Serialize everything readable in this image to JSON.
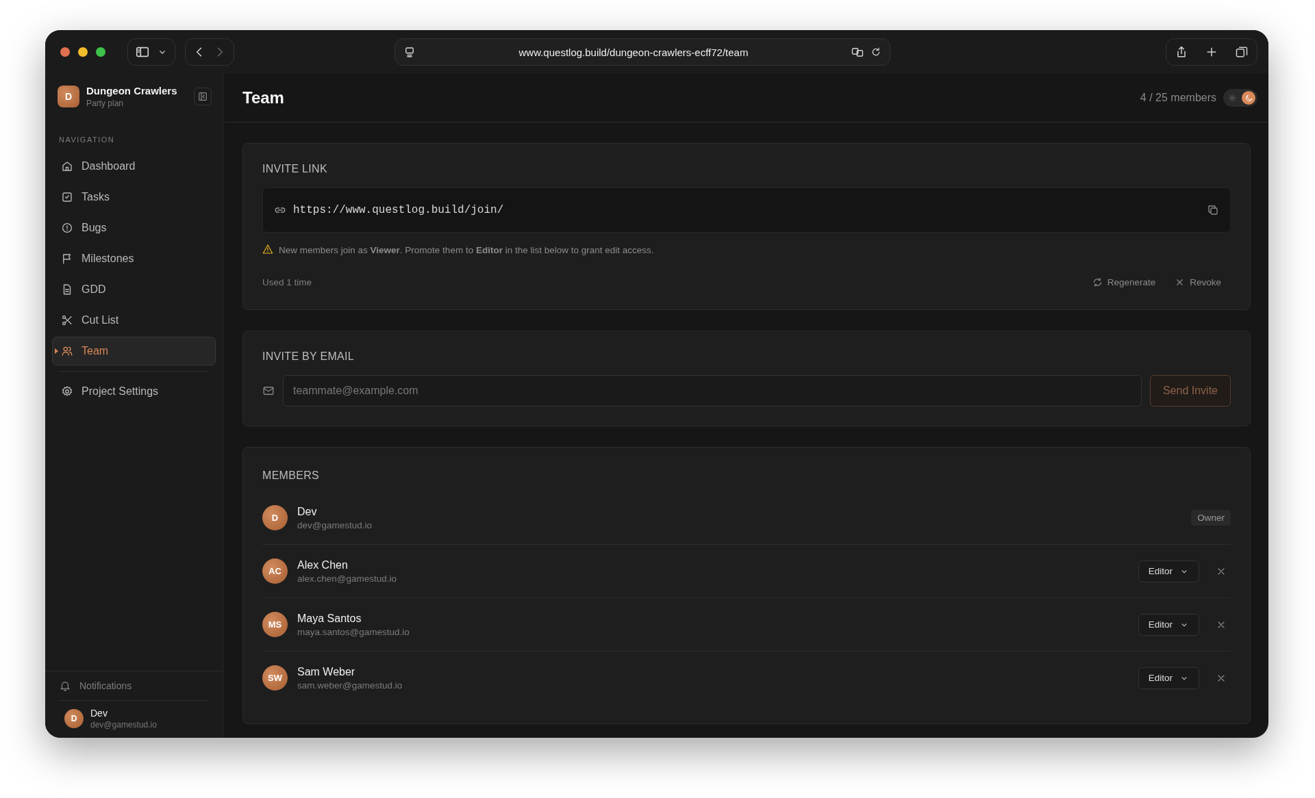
{
  "browser": {
    "url": "www.questlog.build/dungeon-crawlers-ecff72/team"
  },
  "sidebar": {
    "project": {
      "avatar": "D",
      "name": "Dungeon Crawlers",
      "plan": "Party plan"
    },
    "section_label": "NAVIGATION",
    "items": [
      {
        "label": "Dashboard",
        "selected": false
      },
      {
        "label": "Tasks",
        "selected": false
      },
      {
        "label": "Bugs",
        "selected": false
      },
      {
        "label": "Milestones",
        "selected": false
      },
      {
        "label": "GDD",
        "selected": false
      },
      {
        "label": "Cut List",
        "selected": false
      },
      {
        "label": "Team",
        "selected": true
      }
    ],
    "settings_item": {
      "label": "Project Settings",
      "selected": false
    },
    "notifications": "Notifications",
    "user": {
      "avatar": "D",
      "name": "Dev",
      "email": "dev@gamestud.io"
    }
  },
  "header": {
    "title": "Team",
    "member_count": "4 / 25 members",
    "dark_mode": true
  },
  "invite_link": {
    "title": "INVITE LINK",
    "url": "https://www.questlog.build/join/",
    "note": "New members join as **Viewer**. Promote them to **Editor** in the list below to grant edit access.",
    "usage": "Used 1 time",
    "actions": [
      "Regenerate",
      "Revoke"
    ]
  },
  "invite_email": {
    "title": "INVITE BY EMAIL",
    "placeholder": "teammate@example.com",
    "button": "Send Invite"
  },
  "members": {
    "title": "MEMBERS",
    "rows": [
      {
        "initials": "D",
        "name": "Dev",
        "email": "dev@gamestud.io",
        "kind": "owner",
        "role": "Owner"
      },
      {
        "initials": "AC",
        "name": "Alex Chen",
        "email": "alex.chen@gamestud.io",
        "kind": "editable",
        "role": "Editor"
      },
      {
        "initials": "MS",
        "name": "Maya Santos",
        "email": "maya.santos@gamestud.io",
        "kind": "editable",
        "role": "Editor"
      },
      {
        "initials": "SW",
        "name": "Sam Weber",
        "email": "sam.weber@gamestud.io",
        "kind": "editable",
        "role": "Editor"
      }
    ]
  }
}
